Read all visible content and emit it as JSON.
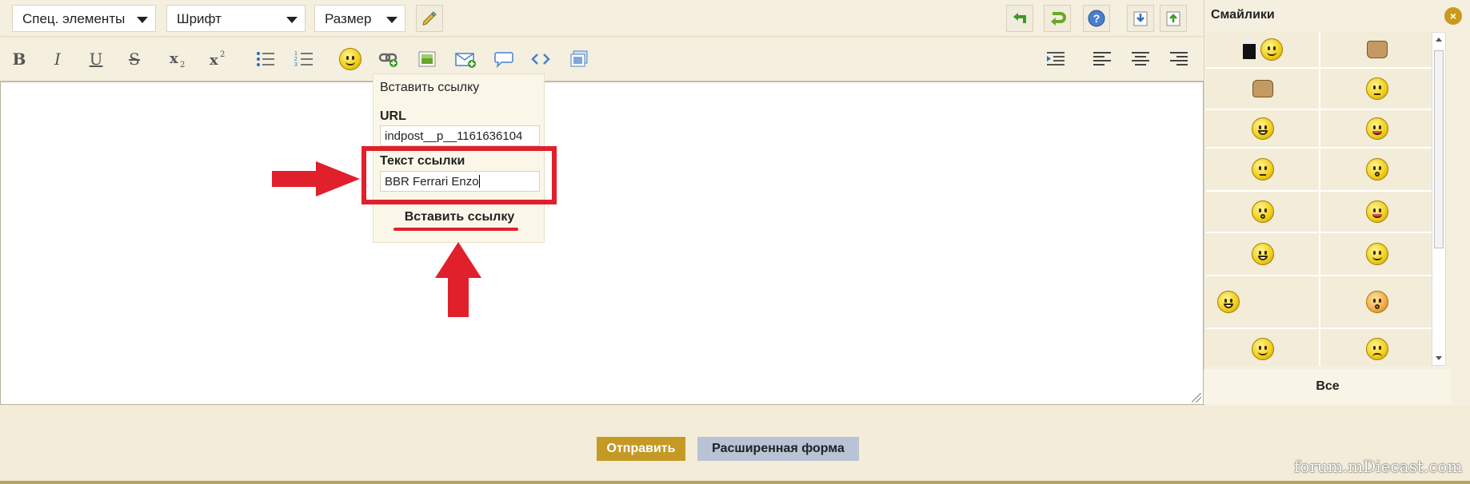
{
  "toolbar": {
    "dropdowns": [
      {
        "label": "Спец. элементы"
      },
      {
        "label": "Шрифт"
      },
      {
        "label": "Размер"
      }
    ],
    "format_buttons": {
      "bold": "B",
      "italic": "I",
      "underline": "U",
      "strike": "S"
    }
  },
  "link_popup": {
    "title": "Вставить ссылку",
    "url_label": "URL",
    "url_value": "indpost__p__1161636104",
    "text_label": "Текст  ссылки",
    "text_value": "BBR  Ferrari  Enzo",
    "insert_button": "Вставить  ссылку"
  },
  "smileys": {
    "title": "Смайлики",
    "close": "×",
    "all_label": "Все",
    "rows": [
      [
        "beer-smiley-icon",
        "thumbs-down-icon"
      ],
      [
        "thumbs-up-icon",
        "rolling-eyes-smiley-icon"
      ],
      [
        "laughing-smiley-icon",
        "tongue-smiley-icon"
      ],
      [
        "neutral-smiley-icon",
        "surprised-smiley-icon"
      ],
      [
        "confused-smiley-icon",
        "crazy-smiley-icon"
      ],
      [
        "big-grin-smiley-icon",
        "smile-smiley-icon"
      ],
      [
        "dancing-smiley-icon",
        "shocked-smiley-icon"
      ],
      [
        "happy-smiley-icon",
        "sad-smiley-icon"
      ]
    ]
  },
  "actions": {
    "send": "Отправить",
    "advanced": "Расширенная форма"
  },
  "watermark": "forum.mDiecast.com",
  "colors": {
    "background": "#f3ecd8",
    "send_button": "#c49a25",
    "advanced_button": "#b8c3d6",
    "annotation_red": "#e0202a"
  }
}
